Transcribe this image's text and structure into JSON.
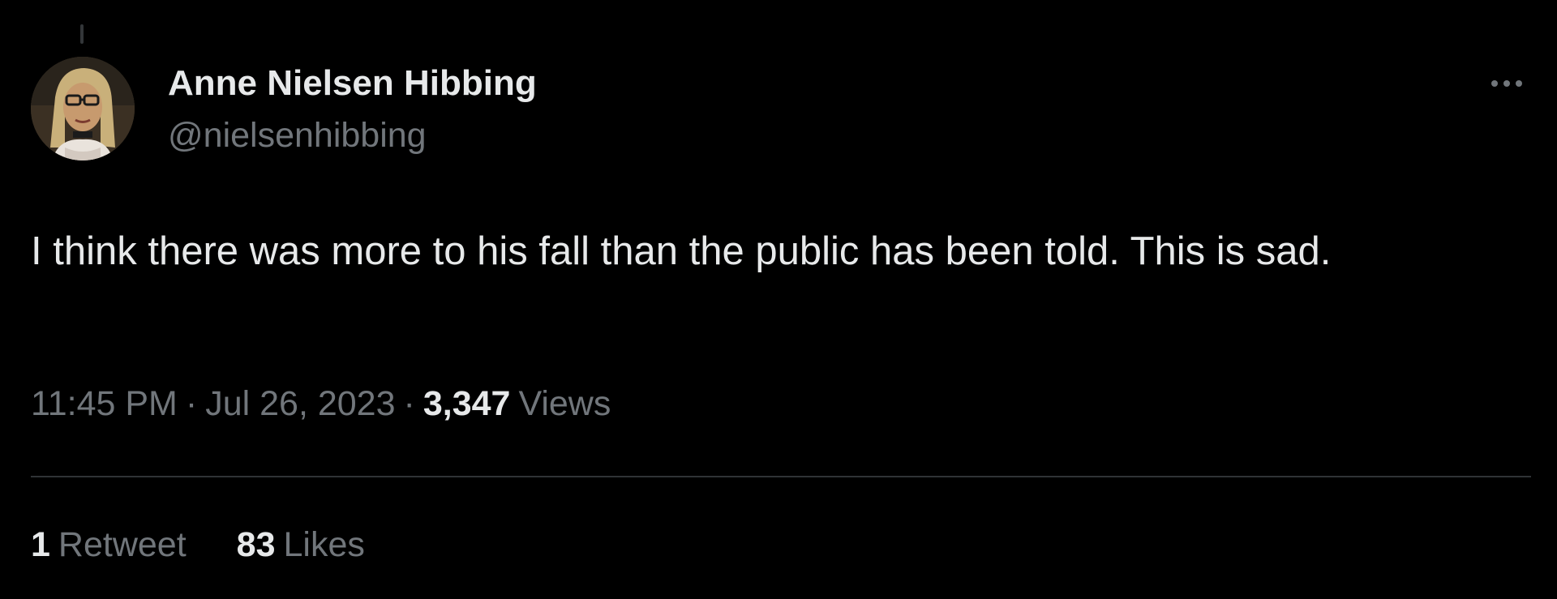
{
  "tweet": {
    "author": {
      "display_name": "Anne Nielsen Hibbing",
      "handle": "@nielsenhibbing",
      "avatar_icon": "user-avatar-portrait"
    },
    "more_icon": "more-horizontal-icon",
    "text": "I think there was more to his fall than the public has been told. This is sad.",
    "time": "11:45 PM",
    "date": "Jul 26, 2023",
    "separator": "·",
    "views_count": "3,347",
    "views_label": "Views",
    "stats": {
      "retweets_count": "1",
      "retweets_label": "Retweet",
      "likes_count": "83",
      "likes_label": "Likes"
    }
  },
  "colors": {
    "background": "#000000",
    "primary_text": "#e7e9ea",
    "secondary_text": "#71767b",
    "divider": "#2f3336"
  }
}
